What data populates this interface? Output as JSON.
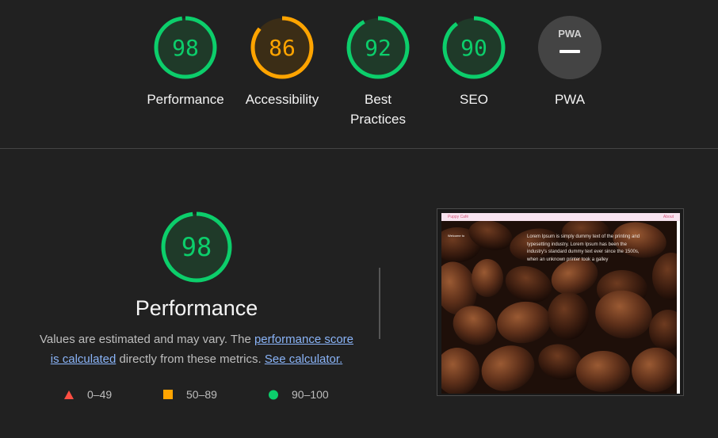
{
  "categories": [
    {
      "score": "98",
      "label": "Performance",
      "value": 98,
      "status": "pass"
    },
    {
      "score": "86",
      "label": "Accessibility",
      "value": 86,
      "status": "average"
    },
    {
      "score": "92",
      "label": "Best Practices",
      "value": 92,
      "status": "pass"
    },
    {
      "score": "90",
      "label": "SEO",
      "value": 90,
      "status": "pass"
    },
    {
      "score": "—",
      "label": "PWA",
      "value": null,
      "status": "na",
      "badge": "PWA"
    }
  ],
  "performance": {
    "score": "98",
    "value": 98,
    "title": "Performance",
    "desc_part1": "Values are estimated and may vary. The ",
    "link_score": "performance score is calculated",
    "desc_part2": " directly from these metrics. ",
    "link_calc": "See calculator.",
    "legend": [
      {
        "icon": "triangle-icon",
        "range": "0–49"
      },
      {
        "icon": "square-icon",
        "range": "50–89"
      },
      {
        "icon": "circle-icon",
        "range": "90–100"
      }
    ]
  },
  "screenshot": {
    "brand": "Puppy Café",
    "nav_link": "About",
    "welcome": "Welcome to",
    "lorem": "Lorem Ipsum is simply dummy text of the printing and typesetting industry. Lorem Ipsum has been the industry's standard dummy text ever since the 1500s, when an unknown printer took a galley"
  },
  "colors": {
    "pass": "#0cce6b",
    "pass_bg": "#1f3a29",
    "average": "#ffa400",
    "average_bg": "#3b2d16",
    "fail": "#ff4e42",
    "na": "#555555",
    "background": "#212121",
    "link": "#8ab4f8"
  }
}
